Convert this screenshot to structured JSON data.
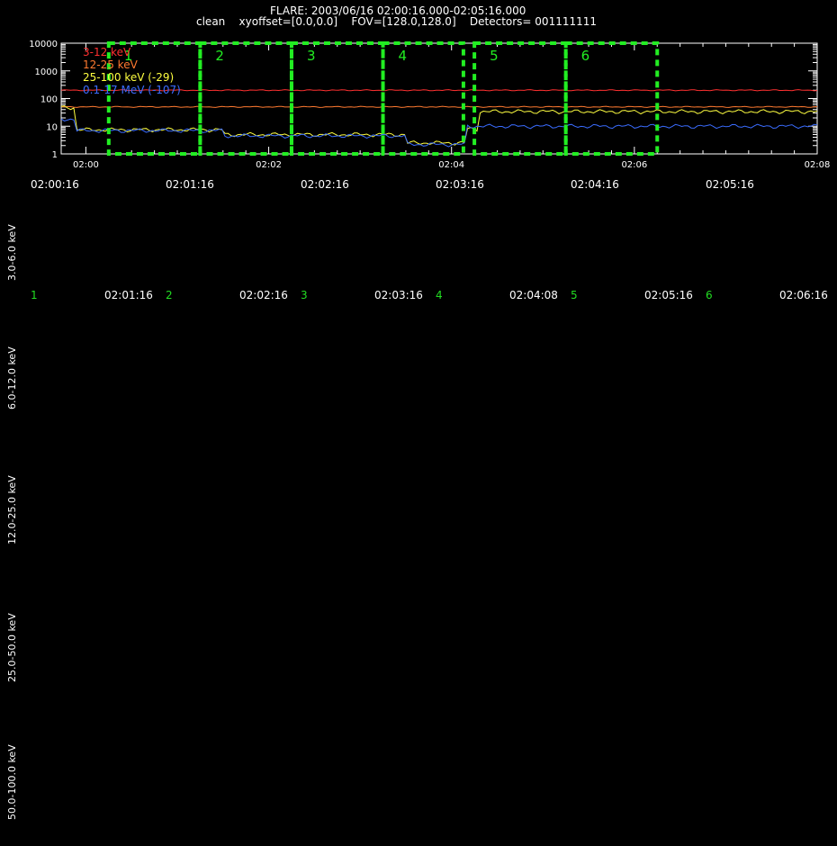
{
  "header": {
    "title": "FLARE: 2003/06/16 02:00:16.000-02:05:16.000",
    "subtitle": "clean    xyoffset=[0.0,0.0]    FOV=[128.0,128.0]    Detectors= 001111111"
  },
  "colors": {
    "background": "#000000",
    "axis": "#ffffff",
    "box": "#22ee22",
    "s1": "#ff3030",
    "s2": "#ff7a30",
    "s3": "#ffff40",
    "s4": "#3a6cff"
  },
  "chart_data": {
    "type": "line",
    "yscale": "log",
    "ylim": [
      1,
      10000
    ],
    "xlim_minutes": [
      -0.27,
      8.0
    ],
    "ytick_labels": [
      "1",
      "10",
      "100",
      "1000",
      "10000"
    ],
    "xtick_labels": [
      "02:00",
      "02:02",
      "02:04",
      "02:06",
      "02:08"
    ],
    "legend_position": "top-left",
    "series": [
      {
        "name": "3-12 keV",
        "flat_value": 200
      },
      {
        "name": "12-25 keV",
        "flat_value": 50
      },
      {
        "name": "25-100 keV (-29)",
        "pieces": [
          {
            "t0": -0.27,
            "t1": -0.1,
            "v": 48
          },
          {
            "t0": -0.1,
            "t1": 1.5,
            "v": 7.5
          },
          {
            "t0": 1.5,
            "t1": 3.5,
            "v": 5
          },
          {
            "t0": 3.5,
            "t1": 4.15,
            "v": 2.5
          },
          {
            "t0": 4.15,
            "t1": 4.3,
            "v": 8
          },
          {
            "t0": 4.3,
            "t1": 8.0,
            "v": 34
          }
        ]
      },
      {
        "name": "0.1-17 MeV (-107)",
        "pieces": [
          {
            "t0": -0.27,
            "t1": -0.1,
            "v": 18
          },
          {
            "t0": -0.1,
            "t1": 1.5,
            "v": 7
          },
          {
            "t0": 1.5,
            "t1": 3.5,
            "v": 4.5
          },
          {
            "t0": 3.5,
            "t1": 4.15,
            "v": 2.2
          },
          {
            "t0": 4.15,
            "t1": 8.0,
            "v": 10
          }
        ]
      }
    ],
    "intervals": [
      {
        "label": "1",
        "start": 0.25,
        "end": 1.25
      },
      {
        "label": "2",
        "start": 1.25,
        "end": 2.25
      },
      {
        "label": "3",
        "start": 2.25,
        "end": 3.25
      },
      {
        "label": "4",
        "start": 3.25,
        "end": 4.13
      },
      {
        "label": "5",
        "start": 4.25,
        "end": 5.25
      },
      {
        "label": "6",
        "start": 5.25,
        "end": 6.25
      }
    ]
  },
  "time_row_1": [
    "02:00:16",
    "02:01:16",
    "02:02:16",
    "02:03:16",
    "02:04:16",
    "02:05:16"
  ],
  "time_row_2": [
    {
      "num": "1",
      "time": "02:01:16"
    },
    {
      "num": "2",
      "time": "02:02:16"
    },
    {
      "num": "3",
      "time": "02:03:16"
    },
    {
      "num": "4",
      "time": "02:04:08"
    },
    {
      "num": "5",
      "time": "02:05:16"
    },
    {
      "num": "6",
      "time": "02:06:16"
    }
  ],
  "energy_bands": [
    "3.0-6.0 keV",
    "6.0-12.0 keV",
    "12.0-25.0 keV",
    "25.0-50.0 keV",
    "50.0-100.0 keV"
  ]
}
